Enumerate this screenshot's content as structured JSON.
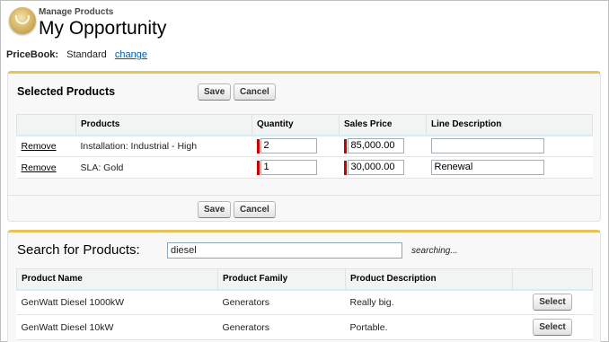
{
  "header": {
    "subtitle": "Manage Products",
    "title": "My Opportunity"
  },
  "pricebook": {
    "label": "PriceBook:",
    "value": "Standard",
    "change_link": "change"
  },
  "selected": {
    "title": "Selected Products",
    "save_label": "Save",
    "cancel_label": "Cancel",
    "columns": [
      "",
      "Products",
      "Quantity",
      "Sales Price",
      "Line Description"
    ],
    "rows": [
      {
        "action": "Remove",
        "product": "Installation: Industrial - High",
        "quantity": "2",
        "price": "85,000.00",
        "description": ""
      },
      {
        "action": "Remove",
        "product": "SLA: Gold",
        "quantity": "1",
        "price": "30,000.00",
        "description": "Renewal"
      }
    ]
  },
  "search": {
    "label": "Search for Products:",
    "value": "diesel",
    "status": "searching...",
    "columns": [
      "Product Name",
      "Product Family",
      "Product Description",
      ""
    ],
    "rows": [
      {
        "name": "GenWatt Diesel 1000kW",
        "family": "Generators",
        "description": "Really big.",
        "action": "Select"
      },
      {
        "name": "GenWatt Diesel 10kW",
        "family": "Generators",
        "description": "Portable.",
        "action": "Select"
      }
    ]
  },
  "colors": {
    "accent_border": "#e8c35a",
    "link": "#015ba7",
    "required_marker": "#cc0000"
  }
}
